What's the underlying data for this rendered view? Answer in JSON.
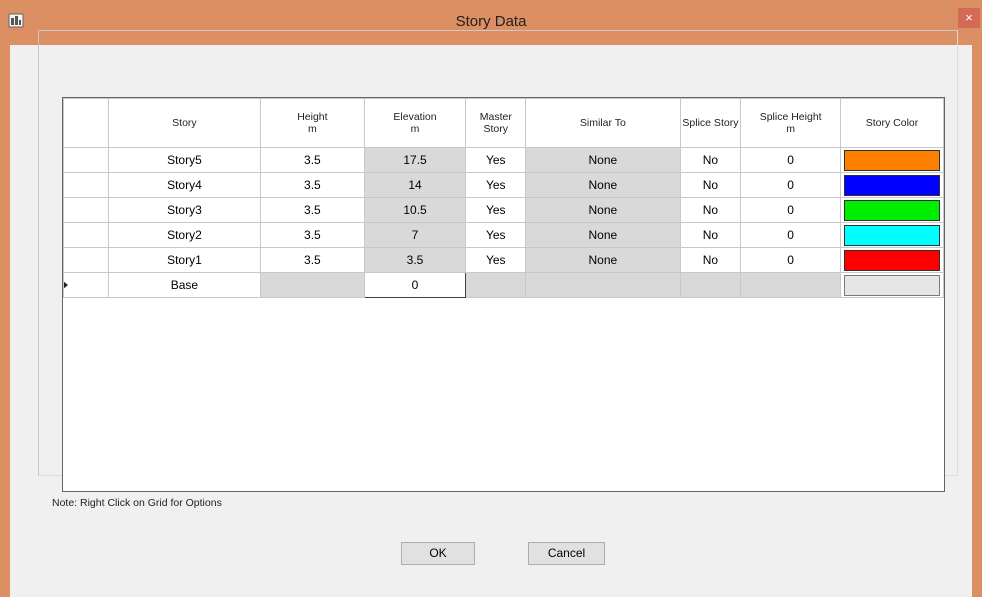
{
  "window": {
    "title": "Story Data",
    "close_symbol": "×"
  },
  "table": {
    "headers": {
      "story": "Story",
      "height": "Height",
      "height_unit": "m",
      "elevation": "Elevation",
      "elevation_unit": "m",
      "master_story": "Master Story",
      "similar_to": "Similar To",
      "splice_story": "Splice Story",
      "splice_height": "Splice Height",
      "splice_height_unit": "m",
      "story_color": "Story Color"
    },
    "rows": [
      {
        "story": "Story5",
        "height": "3.5",
        "elevation": "17.5",
        "master": "Yes",
        "similar": "None",
        "splice": "No",
        "splice_height": "0",
        "color": "#ff8000"
      },
      {
        "story": "Story4",
        "height": "3.5",
        "elevation": "14",
        "master": "Yes",
        "similar": "None",
        "splice": "No",
        "splice_height": "0",
        "color": "#0000ff"
      },
      {
        "story": "Story3",
        "height": "3.5",
        "elevation": "10.5",
        "master": "Yes",
        "similar": "None",
        "splice": "No",
        "splice_height": "0",
        "color": "#00ee00"
      },
      {
        "story": "Story2",
        "height": "3.5",
        "elevation": "7",
        "master": "Yes",
        "similar": "None",
        "splice": "No",
        "splice_height": "0",
        "color": "#00ffff"
      },
      {
        "story": "Story1",
        "height": "3.5",
        "elevation": "3.5",
        "master": "Yes",
        "similar": "None",
        "splice": "No",
        "splice_height": "0",
        "color": "#ff0000"
      }
    ],
    "base_row": {
      "story": "Base",
      "elevation": "0"
    }
  },
  "note": "Note:  Right Click on Grid for Options",
  "buttons": {
    "ok": "OK",
    "cancel": "Cancel"
  }
}
